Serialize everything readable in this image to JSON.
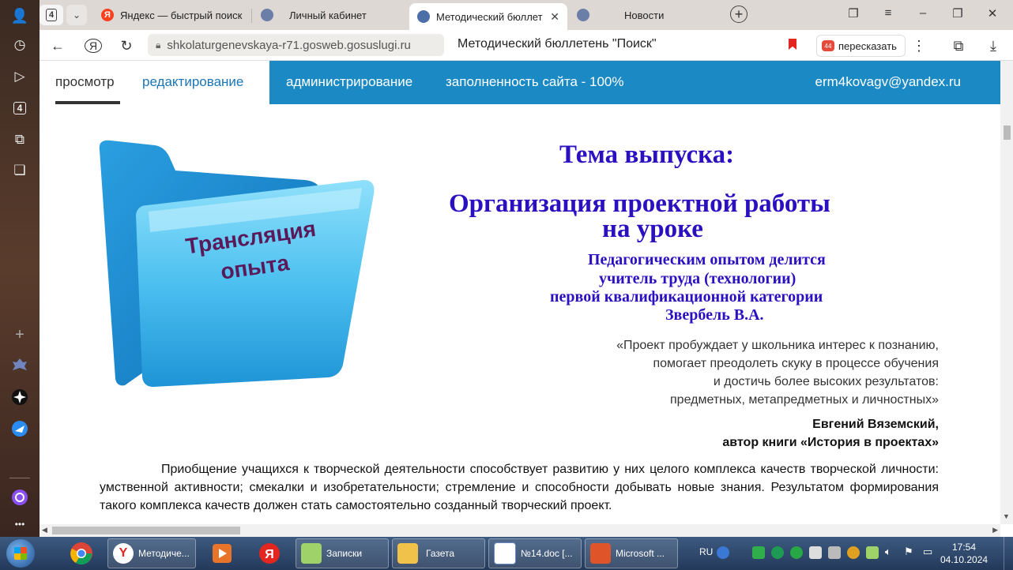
{
  "browser": {
    "tab_count": "4",
    "tabs": [
      {
        "title": "Яндекс — быстрый поиск",
        "active": false
      },
      {
        "title": "Личный кабинет",
        "active": false
      },
      {
        "title": "Методический бюллет",
        "active": true
      },
      {
        "title": "Новости",
        "active": false
      }
    ],
    "url": "shkolaturgenevskaya-r71.gosweb.gosuslugi.ru",
    "page_title": "Методический бюллетень \"Поиск\"",
    "retell_label": "пересказать",
    "sidebar_tab_badge": "4"
  },
  "site_bar": {
    "view": "просмотр",
    "edit": "редактирование",
    "admin": "администрирование",
    "fill": "заполненность сайта - 100%",
    "user": "erm4kovagv@yandex.ru"
  },
  "content": {
    "folder_label_line1": "Трансляция",
    "folder_label_line2": "опыта",
    "theme_label": "Тема выпуска:",
    "topic_line1": "Организация проектной работы",
    "topic_line2": "на уроке",
    "shared_by": [
      "Педагогическим опытом делится",
      "учитель труда (технологии)",
      "первой квалификационной категории",
      "Звербель В.А."
    ],
    "quote_lines": [
      "«Проект пробуждает у школьника интерес к познанию,",
      "помогает преодолеть скуку в процессе обучения",
      "и достичь более высоких результатов:",
      "предметных, метапредметных и личностных»"
    ],
    "author_name": "Евгений Вяземский,",
    "author_book": "автор  книги «История в проектах»",
    "paragraph": "Приобщение учащихся к творческой деятельности способствует развитию у них целого комплекса качеств творческой личности: умственной активности; смекалки и изобретательности; стремление и способности добывать новые знания. Результатом формирования такого комплекса качеств должен стать самостоятельно созданный творческий проект."
  },
  "taskbar": {
    "tasks": [
      "Методиче...",
      "Записки",
      "Газета",
      "№14.doc [...",
      "Microsoft ..."
    ],
    "lang": "RU",
    "time": "17:54",
    "date": "04.10.2024"
  },
  "colors": {
    "site_bar_blue": "#1b8ac4",
    "title_blue": "#2a10c0",
    "folder_text": "#5a1a5a",
    "bookmark_red": "#e3261f"
  }
}
